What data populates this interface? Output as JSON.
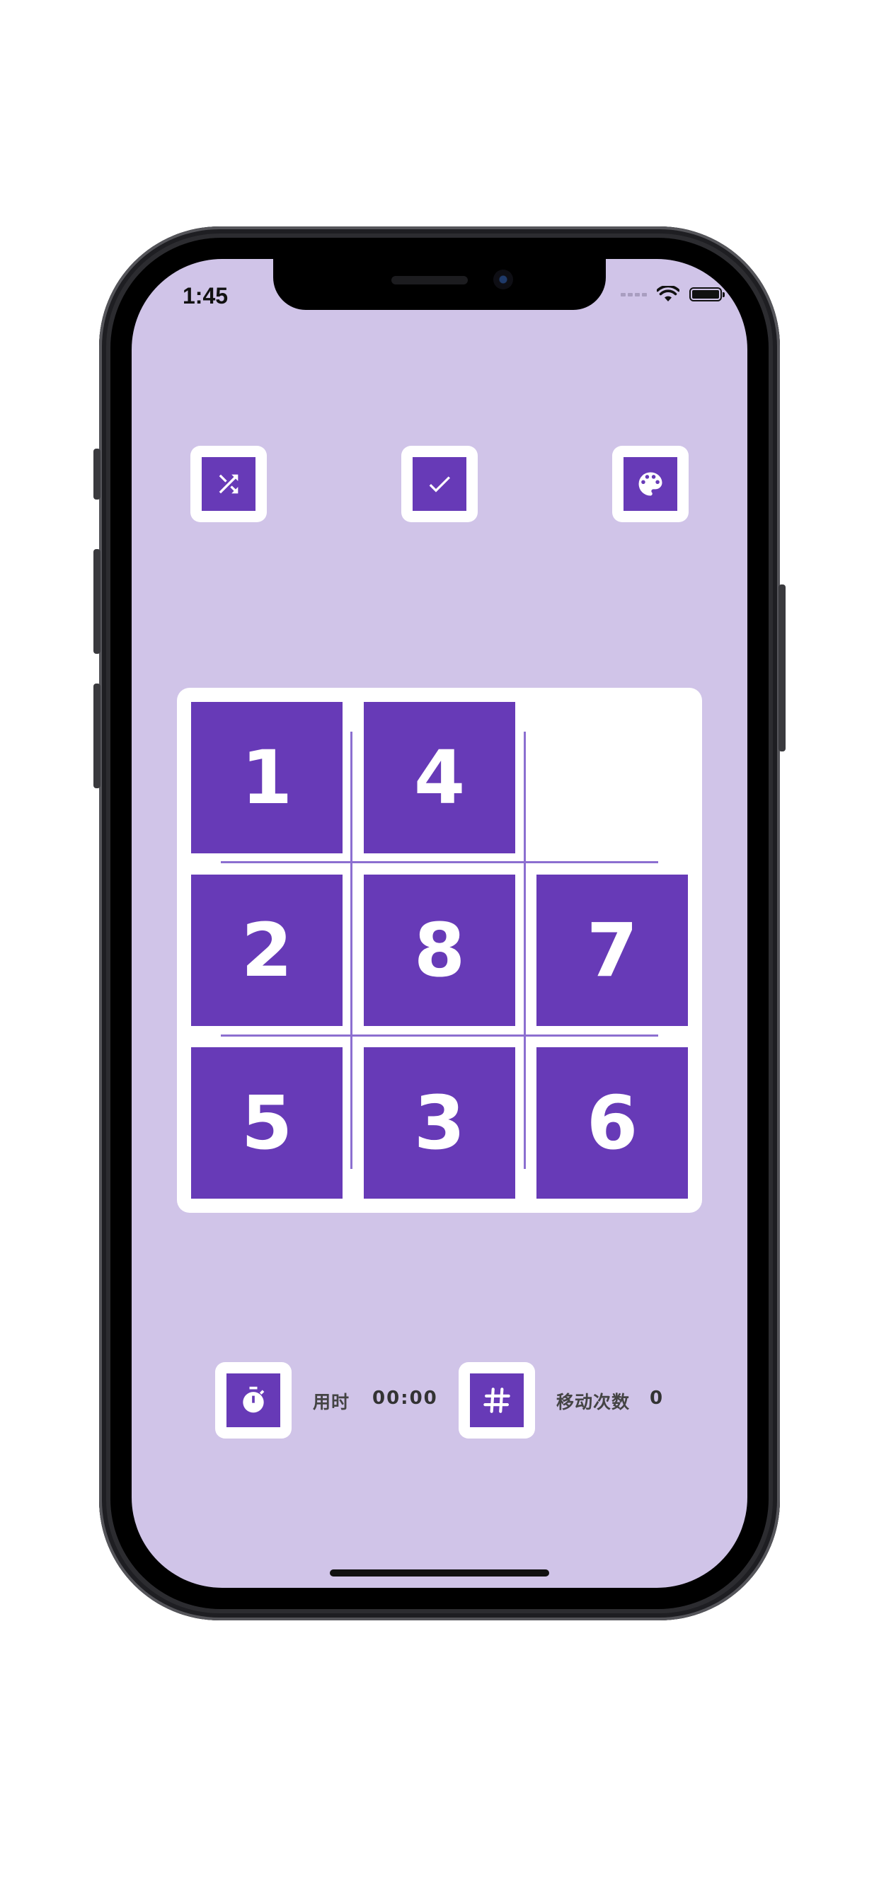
{
  "status": {
    "time": "1:45"
  },
  "toolbar": {
    "shuffle_icon": "shuffle-icon",
    "check_icon": "check-icon",
    "palette_icon": "palette-icon"
  },
  "board": {
    "tiles": [
      "1",
      "4",
      "",
      "2",
      "8",
      "7",
      "5",
      "3",
      "6"
    ]
  },
  "stats": {
    "time_label": "用时",
    "time_value": "00:00",
    "moves_label": "移动次数",
    "moves_value": "0"
  },
  "colors": {
    "accent": "#673ab7",
    "background": "#d0c4e8",
    "board": "#ffffff"
  }
}
